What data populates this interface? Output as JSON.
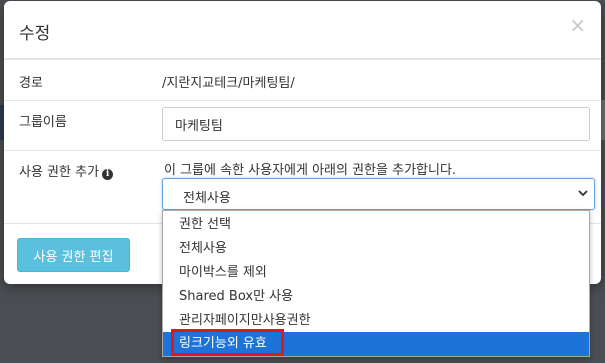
{
  "modal": {
    "title": "수정",
    "close_glyph": "×"
  },
  "fields": {
    "path": {
      "label": "경로",
      "value": "/지란지교테크/마케팅팀/"
    },
    "group_name": {
      "label": "그룹이름",
      "value": "마케팅팀"
    },
    "permission": {
      "label": "사용 권한 추가",
      "info_glyph": "i",
      "help": "이 그룹에 속한 사용자에게 아래의 권한을 추가합니다.",
      "selected": "전체사용"
    }
  },
  "footer": {
    "edit_button": "사용 권한 편집"
  },
  "dropdown": {
    "options": [
      "권한 선택",
      "전체사용",
      "마이박스를 제외",
      "Shared Box만 사용",
      "관리자페이지만사용권한",
      "링크기능외 유효"
    ],
    "highlighted_index": 5
  },
  "colors": {
    "accent": "#5bc0de",
    "selection": "#1e73d8",
    "highlight_box": "#e01818"
  }
}
